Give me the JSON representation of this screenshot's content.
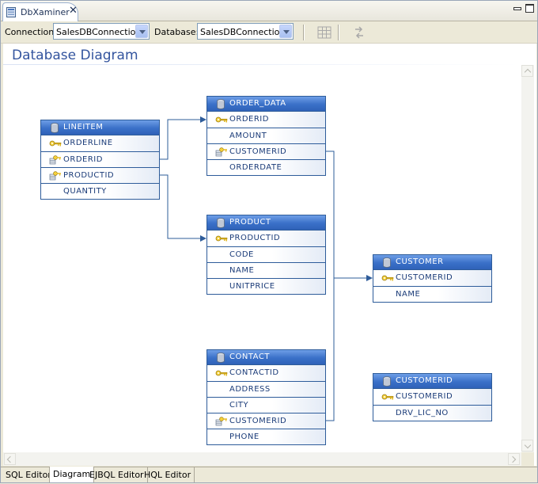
{
  "window": {
    "tab_title": "DbXaminer"
  },
  "toolbar": {
    "connection_label": "Connection:",
    "connection_value": "SalesDBConnection",
    "database_label": "Database:",
    "database_value": "SalesDBConnection"
  },
  "diagram": {
    "title": "Database Diagram",
    "entities": [
      {
        "name": "LINEITEM",
        "columns": [
          {
            "label": "ORDERLINE",
            "icon": "primary-key-icon"
          },
          {
            "label": "ORDERID",
            "icon": "foreign-key-icon"
          },
          {
            "label": "PRODUCTID",
            "icon": "foreign-key-icon"
          },
          {
            "label": "QUANTITY",
            "icon": ""
          }
        ]
      },
      {
        "name": "ORDER_DATA",
        "columns": [
          {
            "label": "ORDERID",
            "icon": "primary-key-icon"
          },
          {
            "label": "AMOUNT",
            "icon": ""
          },
          {
            "label": "CUSTOMERID",
            "icon": "foreign-key-icon"
          },
          {
            "label": "ORDERDATE",
            "icon": ""
          }
        ]
      },
      {
        "name": "PRODUCT",
        "columns": [
          {
            "label": "PRODUCTID",
            "icon": "primary-key-icon"
          },
          {
            "label": "CODE",
            "icon": ""
          },
          {
            "label": "NAME",
            "icon": ""
          },
          {
            "label": "UNITPRICE",
            "icon": ""
          }
        ]
      },
      {
        "name": "CUSTOMER",
        "columns": [
          {
            "label": "CUSTOMERID",
            "icon": "primary-key-icon"
          },
          {
            "label": "NAME",
            "icon": ""
          }
        ]
      },
      {
        "name": "CONTACT",
        "columns": [
          {
            "label": "CONTACTID",
            "icon": "primary-key-icon"
          },
          {
            "label": "ADDRESS",
            "icon": ""
          },
          {
            "label": "CITY",
            "icon": ""
          },
          {
            "label": "CUSTOMERID",
            "icon": "foreign-key-icon"
          },
          {
            "label": "PHONE",
            "icon": ""
          }
        ]
      },
      {
        "name": "CUSTOMERID",
        "columns": [
          {
            "label": "CUSTOMERID",
            "icon": "primary-key-icon"
          },
          {
            "label": "DRV_LIC_NO",
            "icon": ""
          }
        ]
      }
    ]
  },
  "editor_tabs": [
    {
      "label": "SQL Editor"
    },
    {
      "label": "Diagram"
    },
    {
      "label": "EJBQL Editor"
    },
    {
      "label": "HQL Editor"
    }
  ],
  "colors": {
    "header_blue": "#3a70c8",
    "border_blue": "#2e5c9a",
    "title_blue": "#33549e",
    "column_text": "#1a3b78"
  }
}
